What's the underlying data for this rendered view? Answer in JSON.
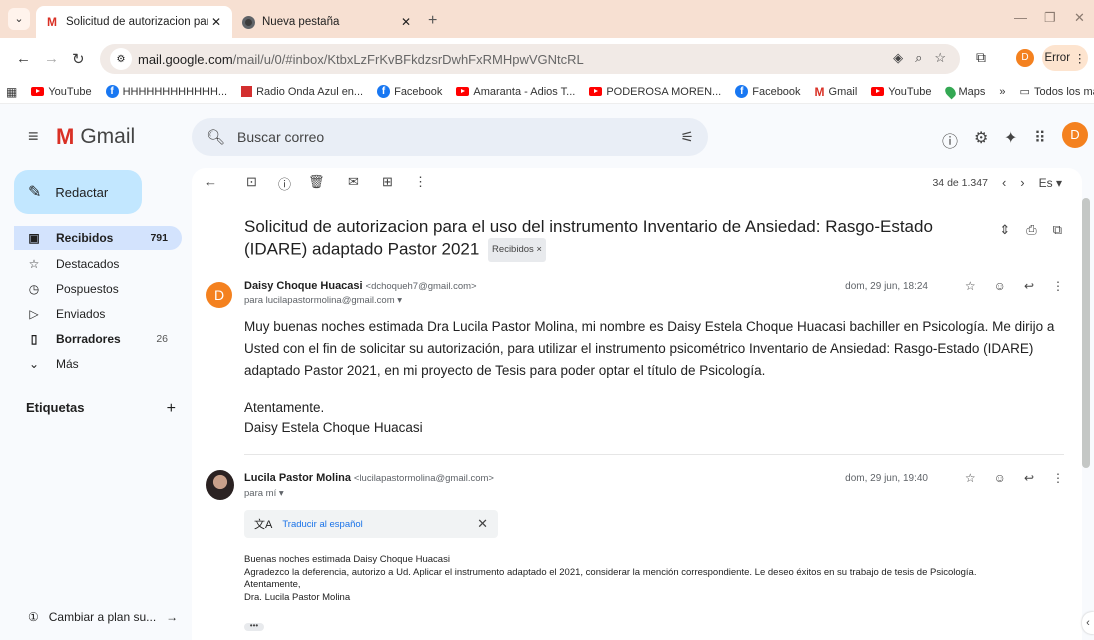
{
  "browser": {
    "tabs": [
      {
        "title": "Solicitud de autorizacion para e",
        "active": true,
        "icon": "gmail-icon"
      },
      {
        "title": "Nueva pestaña",
        "active": false,
        "icon": "chrome-icon"
      }
    ],
    "url_host": "mail.google.com",
    "url_path": "/mail/u/0/#inbox/KtbxLzFrKvBFkdzsrDwhFxRMHpwVGNtcRL",
    "profile_initial": "D",
    "error_label": "Error",
    "bookmarks": [
      {
        "label": "YouTube",
        "icon": "youtube-icon"
      },
      {
        "label": "HHHHHHHHHHHH...",
        "icon": "facebook-icon"
      },
      {
        "label": "Radio Onda Azul en...",
        "icon": "radio-icon"
      },
      {
        "label": "Facebook",
        "icon": "facebook-icon"
      },
      {
        "label": "Amaranta - Adios T...",
        "icon": "youtube-icon"
      },
      {
        "label": "PODEROSA MOREN...",
        "icon": "youtube-icon"
      },
      {
        "label": "Facebook",
        "icon": "facebook-icon"
      },
      {
        "label": "Gmail",
        "icon": "gmail-icon"
      },
      {
        "label": "YouTube",
        "icon": "youtube-icon"
      },
      {
        "label": "Maps",
        "icon": "maps-icon"
      }
    ],
    "all_bookmarks": "Todos los marcadores"
  },
  "gmail": {
    "logo_text": "Gmail",
    "search_placeholder": "Buscar correo",
    "avatar_initial": "D",
    "compose_label": "Redactar",
    "nav": [
      {
        "label": "Recibidos",
        "count": "791",
        "icon": "inbox-icon",
        "selected": true
      },
      {
        "label": "Destacados",
        "count": "",
        "icon": "star-icon",
        "selected": false
      },
      {
        "label": "Pospuestos",
        "count": "",
        "icon": "clock-icon",
        "selected": false
      },
      {
        "label": "Enviados",
        "count": "",
        "icon": "send-icon",
        "selected": false
      },
      {
        "label": "Borradores",
        "count": "26",
        "icon": "draft-icon",
        "selected": false
      },
      {
        "label": "Más",
        "count": "",
        "icon": "chevron-down-icon",
        "selected": false
      }
    ],
    "labels_title": "Etiquetas",
    "upgrade_label": "Cambiar a plan su...",
    "pager": "34 de 1.347",
    "lang": "Es"
  },
  "thread": {
    "subject": "Solicitud de autorizacion para el uso del instrumento Inventario de Ansiedad: Rasgo-Estado (IDARE) adaptado Pastor 2021",
    "label_chip": "Recibidos ×",
    "messages": [
      {
        "avatar_initial": "D",
        "avatar_color": "#f4811f",
        "sender_name": "Daisy Choque Huacasi",
        "sender_email": "<dchoqueh7@gmail.com>",
        "to": "para lucilapastormolina@gmail.com",
        "date": "dom, 29 jun, 18:24",
        "body": "Muy buenas noches  estimada Dra Lucila Pastor Molina, mi nombre es Daisy Estela Choque Huacasi bachiller en Psicología. Me dirijo a Usted con el fin de solicitar su autorización, para utilizar el instrumento psicométrico Inventario de Ansiedad: Rasgo-Estado (IDARE) adaptado Pastor 2021, en mi proyecto de Tesis para poder optar el título de Psicología.",
        "closing": "Atentamente.",
        "signature": "Daisy Estela Choque Huacasi"
      },
      {
        "sender_name": "Lucila Pastor Molina",
        "sender_email": "<lucilapastormolina@gmail.com>",
        "to": "para mí",
        "date": "dom, 29 jun, 19:40",
        "translate_label": "Traducir al español",
        "lines": [
          "Buenas noches estimada Daisy Choque Huacasi",
          "Agradezco la deferencia, autorizo a Ud. Aplicar el instrumento adaptado el 2021, considerar la mención correspondiente. Le deseo éxitos en su trabajo de tesis de Psicología.",
          "Atentamente,",
          "Dra. Lucila Pastor Molina"
        ],
        "more": "•••"
      }
    ]
  },
  "colors": {
    "tabstrip": "#f7e0d2",
    "compose_bg": "#c2e7ff",
    "selected_nav": "#d3e3fd",
    "avatar_orange": "#f4811f",
    "link_blue": "#1a73e8"
  }
}
